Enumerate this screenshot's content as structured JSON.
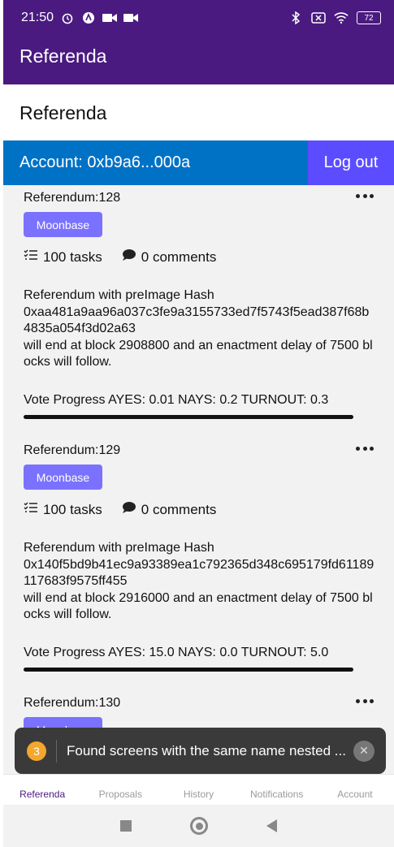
{
  "status_bar": {
    "time": "21:50",
    "battery": "72"
  },
  "app_bar": {
    "title": "Referenda"
  },
  "page": {
    "title": "Referenda"
  },
  "account": {
    "label": "Account: 0xb9a6...000a",
    "logout_label": "Log out"
  },
  "colors": {
    "app_bar": "#4a1a80",
    "account_bar": "#0072c6",
    "logout": "#5b4dff",
    "tag": "#7a72ff"
  },
  "referenda": [
    {
      "title": "Referendum:128",
      "tag": "Moonbase",
      "tasks": "100 tasks",
      "comments": "0 comments",
      "desc_line1": "Referendum with preImage Hash",
      "hash": "0xaa481a9aa96a037c3fe9a3155733ed7f5743f5ead387f68b4835a054f3d02a63",
      "desc_line2": "will end at block 2908800 and an enactment delay of 7500 blocks will follow.",
      "vote": "Vote Progress AYES: 0.01 NAYS: 0.2 TURNOUT: 0.3",
      "progress": 1.0
    },
    {
      "title": "Referendum:129",
      "tag": "Moonbase",
      "tasks": "100 tasks",
      "comments": "0 comments",
      "desc_line1": "Referendum with preImage Hash",
      "hash": "0x140f5bd9b41ec9a93389ea1c792365d348c695179fd61189117683f9575ff455",
      "desc_line2": "will end at block 2916000 and an enactment delay of 7500 blocks will follow.",
      "vote": "Vote Progress AYES: 15.0 NAYS: 0.0 TURNOUT: 5.0",
      "progress": 1.0
    },
    {
      "title": "Referendum:130",
      "tag": "Moonbase"
    }
  ],
  "toast": {
    "count": "3",
    "message": "Found screens with the same name nested ..."
  },
  "tabs": [
    "Referenda",
    "Proposals",
    "History",
    "Notifications",
    "Account"
  ]
}
